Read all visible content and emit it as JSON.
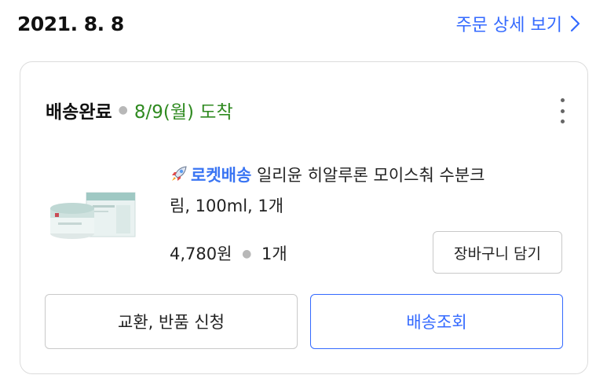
{
  "order": {
    "date": "2021. 8. 8",
    "detail_link_label": "주문 상세 보기"
  },
  "delivery": {
    "status": "배송완료",
    "arrival": "8/9(월) 도착"
  },
  "product": {
    "badge": "로켓배송",
    "name_line1": " 일리윤 히알루론 모이스춰 수분크",
    "name_line2": "림, 100ml, 1개",
    "price": "4,780원",
    "quantity": "1개",
    "thumbnail_icon": "cream-jar-image"
  },
  "buttons": {
    "add_to_cart": "장바구니 담기",
    "exchange_return": "교환, 반품 신청",
    "track_delivery": "배송조회"
  },
  "colors": {
    "accent_blue": "#346aff",
    "arrival_green": "#2f8a20",
    "rocket_blue": "#3a75f3"
  },
  "icons": {
    "detail_chevron": "chevron-right-icon",
    "more": "more-vertical-icon",
    "rocket": "rocket-icon"
  }
}
